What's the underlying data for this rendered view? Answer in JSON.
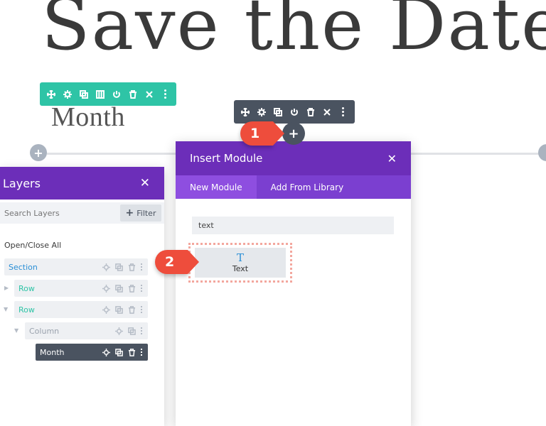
{
  "hero": {
    "title": "Save the Date"
  },
  "content": {
    "heading": "Month"
  },
  "badges": {
    "step1": "1",
    "step2": "2"
  },
  "add_buttons": {
    "plus": "+"
  },
  "layers": {
    "title": "Layers",
    "close": "✕",
    "search_placeholder": "Search Layers",
    "filter_label": "Filter",
    "filter_plus": "+",
    "open_close_all": "Open/Close All",
    "items": [
      {
        "label": "Section"
      },
      {
        "label": "Row"
      },
      {
        "label": "Row"
      },
      {
        "label": "Column"
      },
      {
        "label": "Month"
      }
    ]
  },
  "insert_module": {
    "title": "Insert Module",
    "close": "✕",
    "tabs": [
      {
        "label": "New Module"
      },
      {
        "label": "Add From Library"
      }
    ],
    "search_value": "text",
    "modules": [
      {
        "label": "Text",
        "icon": "text-icon"
      }
    ]
  },
  "colors": {
    "purple_header": "#6c2eb9",
    "purple_tabs": "#7b3fd0",
    "teal": "#2ec4a6",
    "dark_toolbar": "#4a5360",
    "badge_red": "#ee4d3c"
  }
}
